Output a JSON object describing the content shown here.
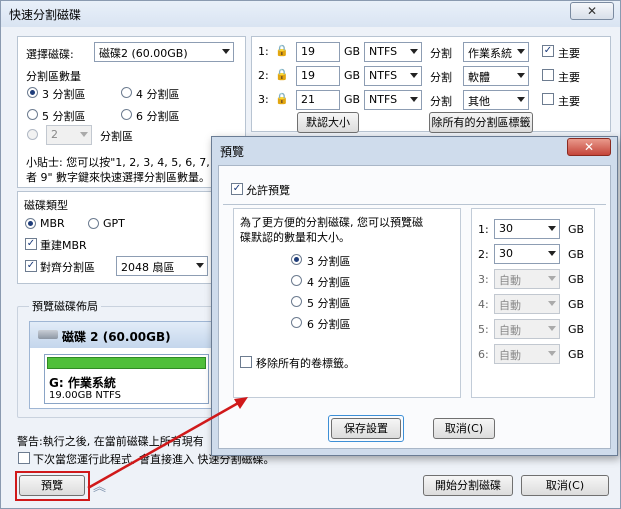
{
  "main": {
    "title": "快速分割磁碟",
    "close": "✕",
    "select_disk_label": "選擇磁碟:",
    "select_disk_value": "磁碟2 (60.00GB)",
    "partition_count_label": "分割區數量",
    "opt3": "3 分割區",
    "opt4": "4 分割區",
    "opt5": "5 分割區",
    "opt6": "6 分割區",
    "custom_count": "2",
    "custom_label": "分割區",
    "tip": "小貼士: 您可以按\"1, 2, 3, 4, 5, 6, 7, 8, 9\"",
    "tip2": "者 9\" 數字鍵來快速選擇分割區數量。",
    "disk_type_label": "磁碟類型",
    "mbr": "MBR",
    "gpt": "GPT",
    "rebuild_mbr": "重建MBR",
    "align": "對齊分割區",
    "align_value": "2048 扇區",
    "preview_layout_label": "預覽磁碟佈局",
    "disk_name": "磁碟 2 (60.00GB)",
    "part_name": "G: 作業系統",
    "part_size": "19.00GB NTFS",
    "warning": "警告:執行之後, 在當前磁碟上所有現有",
    "next_time": "下次當您運行此程式, 會直接進入 快速分割磁碟。",
    "preview_btn": "預覽",
    "start_btn": "開始分割磁碟",
    "cancel_btn": "取消(C)",
    "rows": [
      {
        "idx": "1:",
        "size": "19",
        "unit": "GB",
        "fs": "NTFS",
        "label_text": "分割",
        "name": "作業系統",
        "primary": "主要",
        "primary_checked": true
      },
      {
        "idx": "2:",
        "size": "19",
        "unit": "GB",
        "fs": "NTFS",
        "label_text": "分割",
        "name": "軟體",
        "primary": "主要",
        "primary_checked": false
      },
      {
        "idx": "3:",
        "size": "21",
        "unit": "GB",
        "fs": "NTFS",
        "label_text": "分割",
        "name": "其他",
        "primary": "主要",
        "primary_checked": false
      }
    ],
    "default_size_btn": "默認大小",
    "remove_labels_btn": "除所有的分割區標籤"
  },
  "dialog": {
    "title": "預覽",
    "close": "✕",
    "allow_preview": "允許預覽",
    "desc1": "為了更方便的分割磁碟, 您可以預覽磁",
    "desc2": "碟默認的數量和大小。",
    "opt3": "3 分割區",
    "opt4": "4 分割區",
    "opt5": "5 分割區",
    "opt6": "6 分割區",
    "remove_labels": "移除所有的卷標籤。",
    "save_btn": "保存設置",
    "cancel_btn": "取消(C)",
    "sizes": [
      {
        "idx": "1:",
        "value": "30",
        "unit": "GB",
        "enabled": true
      },
      {
        "idx": "2:",
        "value": "30",
        "unit": "GB",
        "enabled": true
      },
      {
        "idx": "3:",
        "value": "自動",
        "unit": "GB",
        "enabled": false
      },
      {
        "idx": "4:",
        "value": "自動",
        "unit": "GB",
        "enabled": false
      },
      {
        "idx": "5:",
        "value": "自動",
        "unit": "GB",
        "enabled": false
      },
      {
        "idx": "6:",
        "value": "自動",
        "unit": "GB",
        "enabled": false
      }
    ]
  },
  "colors": {
    "annotation": "#d0191a",
    "progress": "#4fbf3a"
  }
}
